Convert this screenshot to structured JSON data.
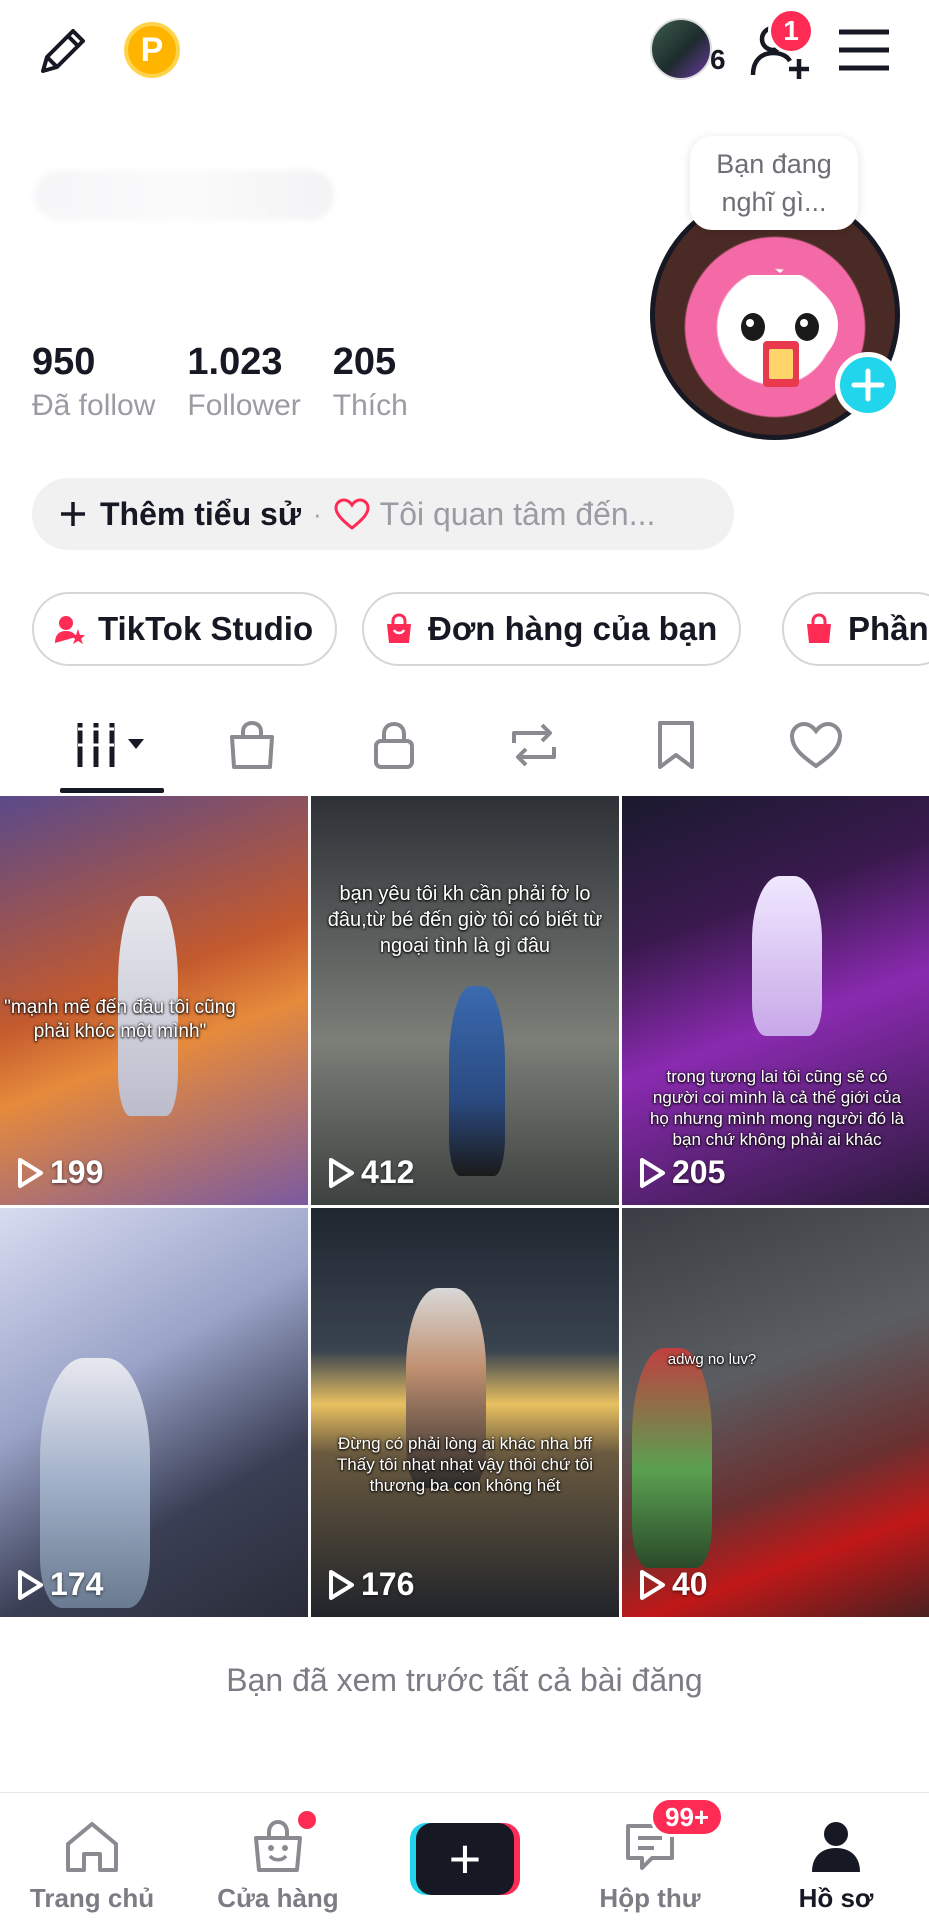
{
  "topbar": {
    "coin_letter": "P",
    "visitor_count": "6",
    "friend_request_badge": "1"
  },
  "profile": {
    "thought_bubble": "Bạn đang nghĩ gì...",
    "stats": [
      {
        "value": "950",
        "label": "Đã follow"
      },
      {
        "value": "1.023",
        "label": "Follower"
      },
      {
        "value": "205",
        "label": "Thích"
      }
    ],
    "bio_add_label": "Thêm tiểu sử",
    "bio_separator": "·",
    "interest_label": "Tôi quan tâm đến..."
  },
  "chips": [
    {
      "label": "TikTok Studio",
      "icon": "studio-icon"
    },
    {
      "label": "Đơn hàng của bạn",
      "icon": "shopping-bag-icon"
    },
    {
      "label": "Phần",
      "icon": "shopping-bag-icon"
    }
  ],
  "tabs": [
    {
      "name": "videos",
      "icon": "grid-icon",
      "active": true
    },
    {
      "name": "shop",
      "icon": "bag-icon"
    },
    {
      "name": "private",
      "icon": "lock-icon"
    },
    {
      "name": "reposts",
      "icon": "repost-icon"
    },
    {
      "name": "favorites",
      "icon": "bookmark-icon"
    },
    {
      "name": "liked",
      "icon": "heart-icon"
    }
  ],
  "videos": [
    {
      "views": "199",
      "caption": "\"mạnh mẽ đến đâu tôi cũng phải khóc một mình\""
    },
    {
      "views": "412",
      "caption": "bạn yêu tôi kh cần phải fờ lo đâu,từ bé đến giờ tôi có biết từ ngoại tình là gì đâu"
    },
    {
      "views": "205",
      "caption": "trong tương lai tôi cũng sẽ có người coi mình là cả thế giới của họ nhưng mình mong người đó là bạn chứ không phải ai khác"
    },
    {
      "views": "174",
      "caption": ""
    },
    {
      "views": "176",
      "caption": "Đừng có phải lòng ai khác nha bff Thấy tôi nhạt nhạt vậy thôi chứ tôi thương ba con không hết"
    },
    {
      "views": "40",
      "caption": "adwg no luv?"
    }
  ],
  "end_message": "Bạn đã xem trước tất cả bài đăng",
  "bottom_nav": {
    "home": "Trang chủ",
    "shop": "Cửa hàng",
    "create": "+",
    "inbox": "Hộp thư",
    "inbox_badge": "99+",
    "profile": "Hồ sơ"
  },
  "colors": {
    "accent_pink": "#fe2c55",
    "accent_cyan": "#20d5ec",
    "text_primary": "#161823",
    "text_secondary": "#9b9ca3"
  }
}
